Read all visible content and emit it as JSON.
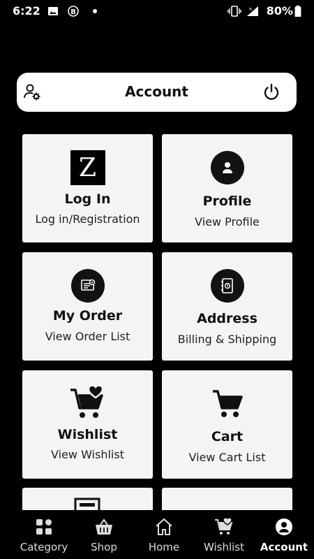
{
  "status_bar": {
    "time": "6:22",
    "battery": "80%"
  },
  "header": {
    "title": "Account",
    "left_icon": "user-settings-icon",
    "right_icon": "power-icon"
  },
  "tiles": [
    {
      "title": "Log In",
      "subtitle": "Log in/Registration",
      "icon": "z-logo",
      "logo_text": "Z"
    },
    {
      "title": "Profile",
      "subtitle": "View Profile",
      "icon": "profile-icon"
    },
    {
      "title": "My Order",
      "subtitle": "View Order List",
      "icon": "order-icon"
    },
    {
      "title": "Address",
      "subtitle": "Billing & Shipping",
      "icon": "address-book-icon"
    },
    {
      "title": "Wishlist",
      "subtitle": "View Wishlist",
      "icon": "wishlist-cart-icon"
    },
    {
      "title": "Cart",
      "subtitle": "View Cart List",
      "icon": "cart-icon"
    }
  ],
  "bottom_nav": [
    {
      "label": "Category",
      "icon": "category-icon"
    },
    {
      "label": "Shop",
      "icon": "shop-basket-icon"
    },
    {
      "label": "Home",
      "icon": "home-icon"
    },
    {
      "label": "Wishlist",
      "icon": "wishlist-icon"
    },
    {
      "label": "Account",
      "icon": "account-icon",
      "active": true
    }
  ],
  "colors": {
    "background": "#000000",
    "card": "#f4f4f4",
    "icon_dark": "#121212"
  }
}
